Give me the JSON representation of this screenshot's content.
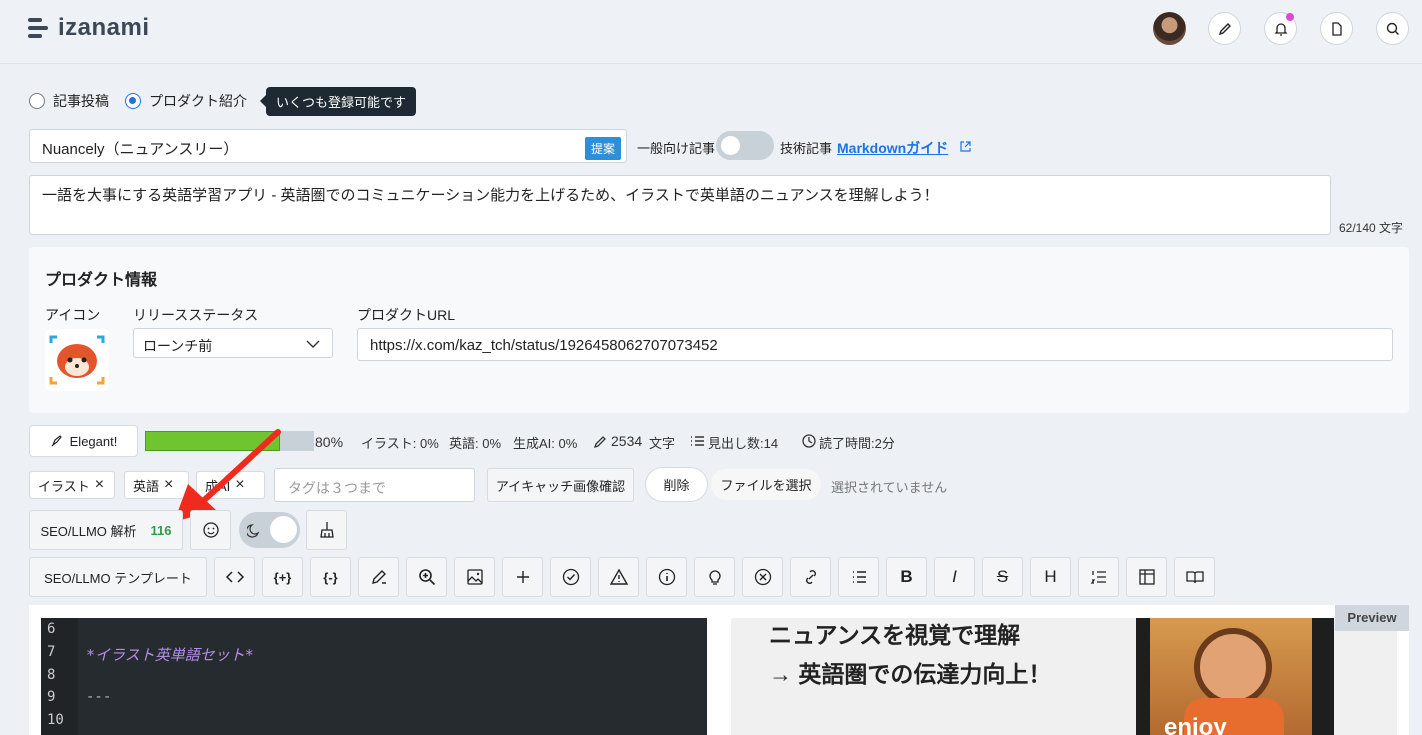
{
  "app": {
    "name": "izanami"
  },
  "post_type": {
    "option1": "記事投稿",
    "option2": "プロダクト紹介",
    "tooltip": "いくつも登録可能です"
  },
  "title": {
    "value": "Nuancely（ニュアンスリー）",
    "suggest": "提案"
  },
  "article_type": {
    "left": "一般向け記事",
    "right": "技術記事"
  },
  "md_guide": "Markdownガイド",
  "description": {
    "value": "一語を大事にする英語学習アプリ - 英語圏でのコミュニケーション能力を上げるため、イラストで英単語のニュアンスを理解しよう！",
    "counter": "62/140 文字"
  },
  "product": {
    "heading": "プロダクト情報",
    "icon_label": "アイコン",
    "status_label": "リリースステータス",
    "status_value": "ローンチ前",
    "url_label": "プロダクトURL",
    "url_value": "https://x.com/kaz_tch/status/1926458062707073452"
  },
  "stats": {
    "elegant": "Elegant!",
    "progress": 0.8,
    "percent": "80%",
    "illust": "イラスト: 0%",
    "english": "英語: 0%",
    "ai": "生成AI: 0%",
    "chars": "2534",
    "chars_unit": "文字",
    "headings": "見出し数:14",
    "reading": "読了時間:2分"
  },
  "tags": {
    "items": [
      "イラスト",
      "英語",
      "成AI"
    ],
    "placeholder": "タグは３つまで",
    "eyecatch": "アイキャッチ画像確認",
    "delete": "削除",
    "file": "ファイルを選択",
    "file_status": "選択されていません"
  },
  "seo": {
    "label": "SEO/LLMO 解析",
    "score": "116",
    "template": "SEO/LLMO テンプレート"
  },
  "editor": {
    "lines": [
      "6",
      "7",
      "8",
      "9",
      "10"
    ],
    "line7": "*イラスト英単語セット*",
    "line9": "---"
  },
  "preview": {
    "label": "Preview",
    "text1": "ニュアンスを視覚で理解",
    "text2": "→ 英語圏での伝達力向上！",
    "img_text": "enjoy"
  },
  "colors": {
    "accent": "#1a73e8",
    "progress": "#6ec530",
    "score": "#2e9e44",
    "arrow": "#ee2b1d"
  }
}
